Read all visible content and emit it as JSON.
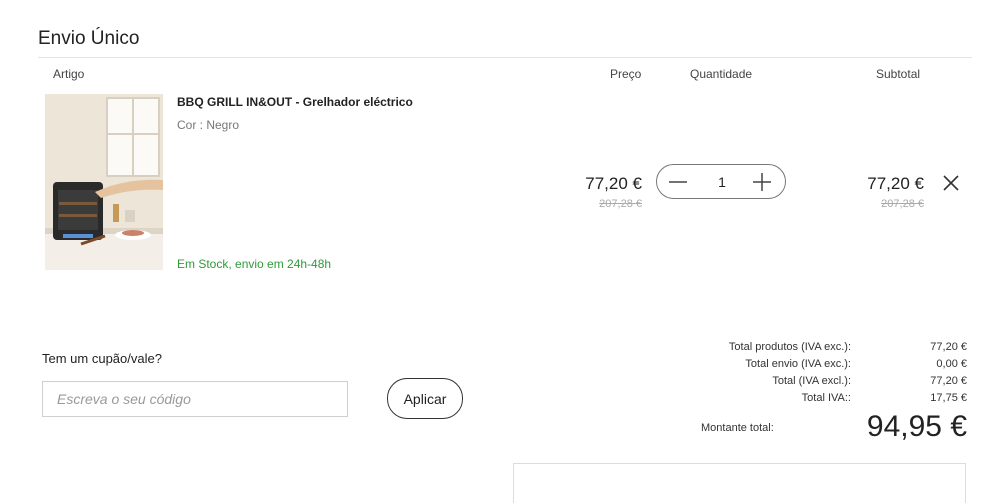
{
  "section": {
    "title": "Envio Único"
  },
  "columns": {
    "artigo": "Artigo",
    "preco": "Preço",
    "quantidade": "Quantidade",
    "subtotal": "Subtotal"
  },
  "product": {
    "name": "BBQ GRILL IN&OUT - Grelhador eléctrico",
    "attribute": "Cor : Negro",
    "stock": "Em Stock, envio em 24h-48h",
    "price": "77,20 €",
    "old_price": "207,28 €",
    "quantity": "1",
    "subtotal": "77,20 €",
    "old_subtotal": "207,28 €"
  },
  "coupon": {
    "label": "Tem um cupão/vale?",
    "placeholder": "Escreva o seu código",
    "apply_label": "Aplicar"
  },
  "summary": {
    "rows": [
      {
        "label": "Total produtos (IVA exc.):",
        "value": "77,20 €"
      },
      {
        "label": "Total envio (IVA exc.):",
        "value": "0,00 €"
      },
      {
        "label": "Total (IVA excl.):",
        "value": "77,20 €"
      },
      {
        "label": "Total IVA::",
        "value": "17,75 €"
      }
    ],
    "total_label": "Montante total:",
    "total_value": "94,95 €"
  },
  "icons": {
    "minus": "minus-icon",
    "plus": "plus-icon",
    "remove": "close-icon"
  },
  "colors": {
    "stock": "#2f9a3a",
    "old_price": "#aaaaaa"
  }
}
